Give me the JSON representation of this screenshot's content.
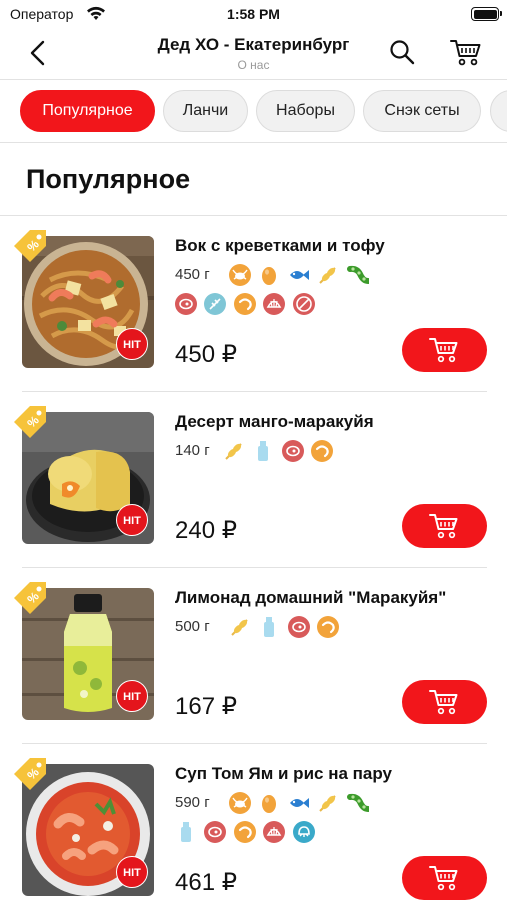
{
  "status_bar": {
    "carrier": "Оператор",
    "time": "1:58 PM"
  },
  "header": {
    "title": "Дед ХО - Екатеринбург",
    "subtitle": "О нас"
  },
  "tabs": [
    {
      "label": "Популярное",
      "active": true
    },
    {
      "label": "Ланчи",
      "active": false
    },
    {
      "label": "Наборы",
      "active": false
    },
    {
      "label": "Снэк сеты",
      "active": false
    }
  ],
  "section": {
    "title": "Популярное"
  },
  "badge": {
    "hit": "HIT"
  },
  "items": [
    {
      "name": "Вок с креветками и тофу",
      "weight": "450 г",
      "price": "450 ₽",
      "allergen_icons": [
        "crab-icon",
        "egg-icon",
        "fish-icon",
        "wheat-icon",
        "soy-icon",
        "meat-icon",
        "sesame-icon",
        "shrimp-icon",
        "shellfish-icon",
        "no-gluten-icon"
      ]
    },
    {
      "name": "Десерт манго-маракуйя",
      "weight": "140 г",
      "price": "240 ₽",
      "allergen_icons": [
        "wheat-icon",
        "milk-icon",
        "meat-icon",
        "shrimp-icon"
      ]
    },
    {
      "name": "Лимонад домашний \"Маракуйя\"",
      "weight": "500 г",
      "price": "167 ₽",
      "allergen_icons": [
        "wheat-icon",
        "milk-icon",
        "meat-icon",
        "shrimp-icon"
      ]
    },
    {
      "name": "Суп Том Ям и рис на пару",
      "weight": "590 г",
      "price": "461 ₽",
      "allergen_icons": [
        "crab-icon",
        "egg-icon",
        "fish-icon",
        "wheat-icon",
        "soy-icon",
        "milk-icon",
        "meat-icon",
        "shrimp-icon",
        "shellfish-icon",
        "mollusk-icon"
      ]
    }
  ],
  "colors": {
    "accent": "#f2161b",
    "tag": "#f6c33a",
    "allergen_orange": "#f2a33a",
    "allergen_red": "#d85a5a",
    "allergen_teal": "#7fc6d6",
    "allergen_blue": "#2b7fd1"
  }
}
